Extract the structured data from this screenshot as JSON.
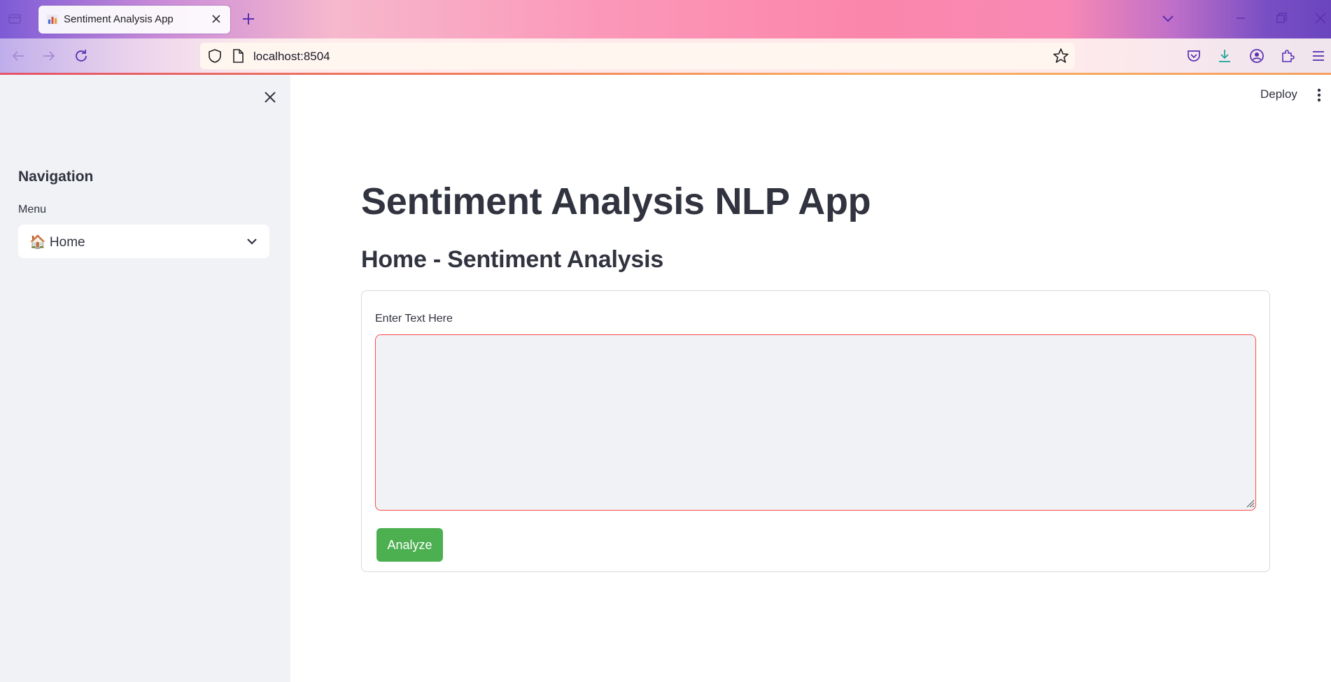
{
  "browser": {
    "tab_title": "Sentiment Analysis App",
    "url": "localhost:8504"
  },
  "sidebar": {
    "title": "Navigation",
    "menu_label": "Menu",
    "menu_selected": "🏠 Home"
  },
  "header": {
    "deploy_label": "Deploy"
  },
  "main": {
    "title": "Sentiment Analysis NLP App",
    "subtitle": "Home - Sentiment Analysis",
    "form": {
      "text_label": "Enter Text Here",
      "text_value": "",
      "submit_label": "Analyze"
    }
  },
  "colors": {
    "accent_red": "#ff4b4b",
    "button_green": "#4caf50",
    "sidebar_bg": "#f0f2f6",
    "text_dark": "#31333f"
  }
}
